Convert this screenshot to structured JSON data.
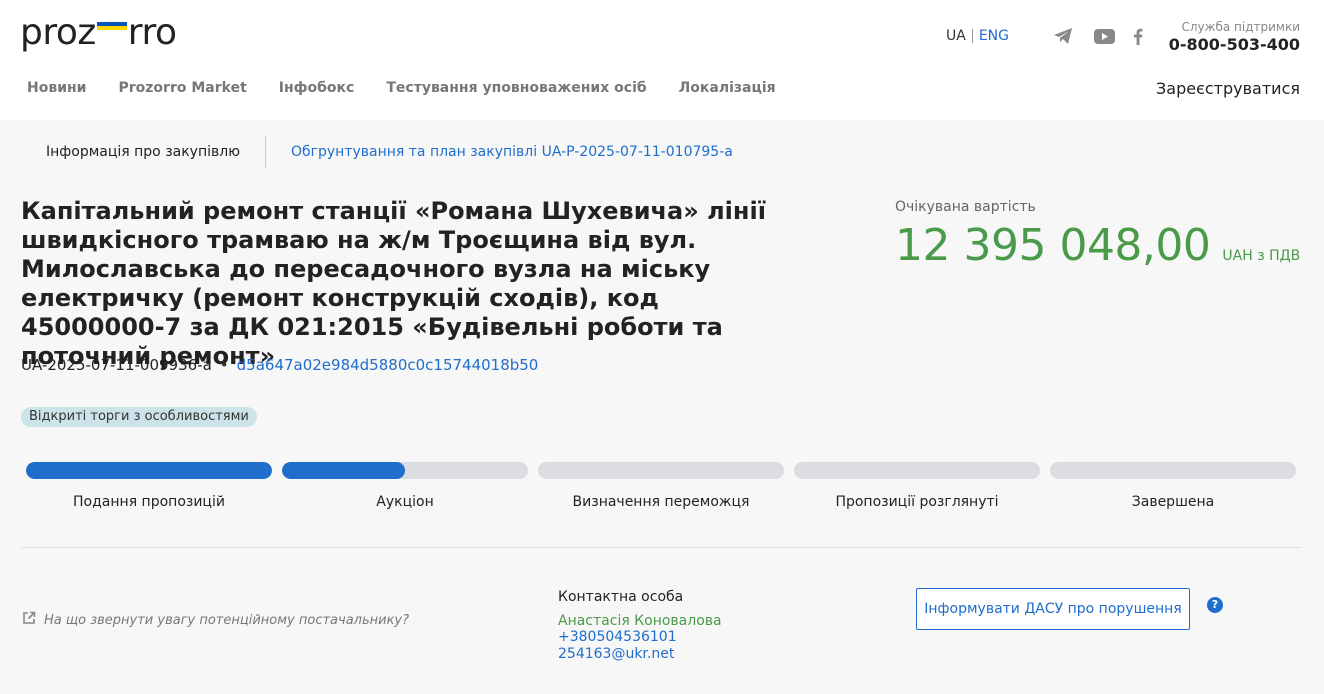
{
  "header": {
    "logo_left": "proz",
    "logo_right": "rro",
    "lang_ua": "UA",
    "lang_eng": "ENG",
    "social_icons": [
      "telegram-icon",
      "youtube-icon",
      "facebook-icon"
    ],
    "support_label": "Служба підтримки",
    "support_phone": "0-800-503-400",
    "register_label": "Зареєструватися",
    "colors": {
      "accent": "#1f6ecb",
      "flag_blue": "#0057b7",
      "flag_yellow": "#ffd500"
    }
  },
  "nav": {
    "items": [
      {
        "label": "Новини"
      },
      {
        "label": "Prozorro Market"
      },
      {
        "label": "Інфобокс"
      },
      {
        "label": "Тестування уповноважених осіб"
      },
      {
        "label": "Локалізація"
      }
    ]
  },
  "tabs": {
    "info": "Інформація про закупівлю",
    "plan": "Обгрунтування та план закупівлі UA-P-2025-07-11-010795-a"
  },
  "tender": {
    "title": "Капітальний ремонт станції «Романа Шухевича» лінії швидкісного трамваю на ж/м Троєщина від вул. Милослав­ська до пересадочного вузла на міську електричку (ремонт конструкцій сходів), код 45000000-7 за ДК 021:2015 «Буді­вельні роботи та поточний ремонт»",
    "id": "UA-2025-07-11-009936-a",
    "separator": "•",
    "hash": "d5a647a02e984d5880c0c15744018b50",
    "badge": "Відкриті торги з особливостями",
    "value_label": "Очікувана вартість",
    "value": "12 395 048,00",
    "currency": "UAH з ПДВ",
    "value_color": "#4a9a4a"
  },
  "stages": [
    {
      "label": "Подання пропозицій",
      "progress": 1.0
    },
    {
      "label": "Аукціон",
      "progress": 0.5
    },
    {
      "label": "Визначення переможця",
      "progress": 0
    },
    {
      "label": "Пропозиції розглянуті",
      "progress": 0
    },
    {
      "label": "Завершена",
      "progress": 0
    }
  ],
  "footer": {
    "hint": "На що звернути увагу потенційному постачальнику?",
    "contact_title": "Контактна особа",
    "contact_name": "Анастасія Коновалова",
    "contact_phone": "+380504536101",
    "contact_email": "254163@ukr.net",
    "dasu_button": "Інформувати ДАСУ про порушення",
    "help_glyph": "?"
  }
}
